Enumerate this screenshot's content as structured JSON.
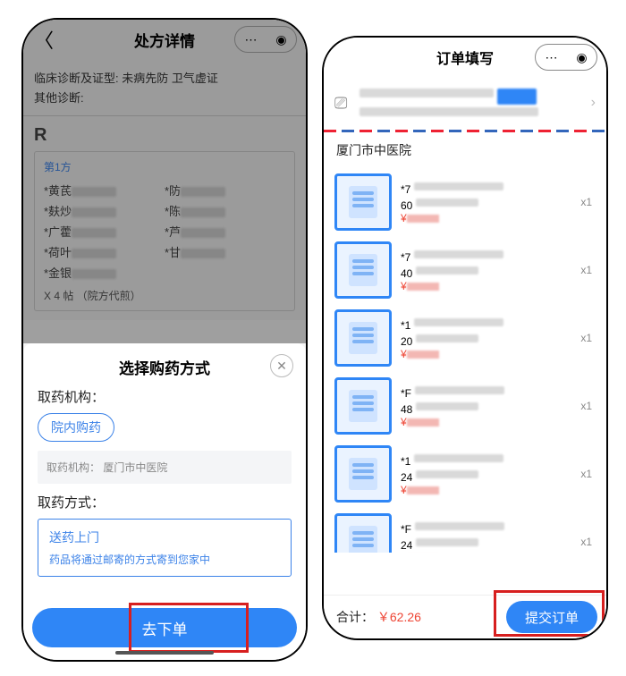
{
  "left": {
    "nav": {
      "title": "处方详情"
    },
    "diagnosis": {
      "line1_label": "临床诊断及证型:",
      "line1_value": "未病先防 卫气虚证",
      "line2_label": "其他诊断:"
    },
    "rx": {
      "R_label": "R",
      "group_label": "第1方",
      "drugs_left": [
        "*黄芪",
        "*麸炒",
        "*广藿",
        "*荷叶",
        "*金银"
      ],
      "drugs_right": [
        "*防",
        "*陈",
        "*芦",
        "*甘"
      ],
      "footer": "X 4 帖 （院方代煎）"
    },
    "sheet": {
      "title": "选择购药方式",
      "org_label": "取药机构：",
      "chip": "院内购药",
      "org_box_label": "取药机构：",
      "org_box_value": "厦门市中医院",
      "method_label": "取药方式：",
      "delivery_title": "送药上门",
      "delivery_desc": "药品将通过邮寄的方式寄到您家中",
      "go_order": "去下单"
    }
  },
  "right": {
    "nav": {
      "title": "订单填写"
    },
    "hospital": "厦门市中医院",
    "items": [
      {
        "name_prefix": "*7",
        "line2": "60",
        "qty": "x1"
      },
      {
        "name_prefix": "*7",
        "line2": "40",
        "qty": "x1"
      },
      {
        "name_prefix": "*1",
        "line2": "20",
        "qty": "x1"
      },
      {
        "name_prefix": "*F",
        "line2": "48",
        "qty": "x1"
      },
      {
        "name_prefix": "*1",
        "line2": "24",
        "qty": "x1"
      },
      {
        "name_prefix": "*F",
        "line2": "24",
        "qty": "x1"
      }
    ],
    "footer": {
      "total_label": "合计：",
      "currency": "￥",
      "amount": "62.26",
      "submit": "提交订单"
    }
  }
}
